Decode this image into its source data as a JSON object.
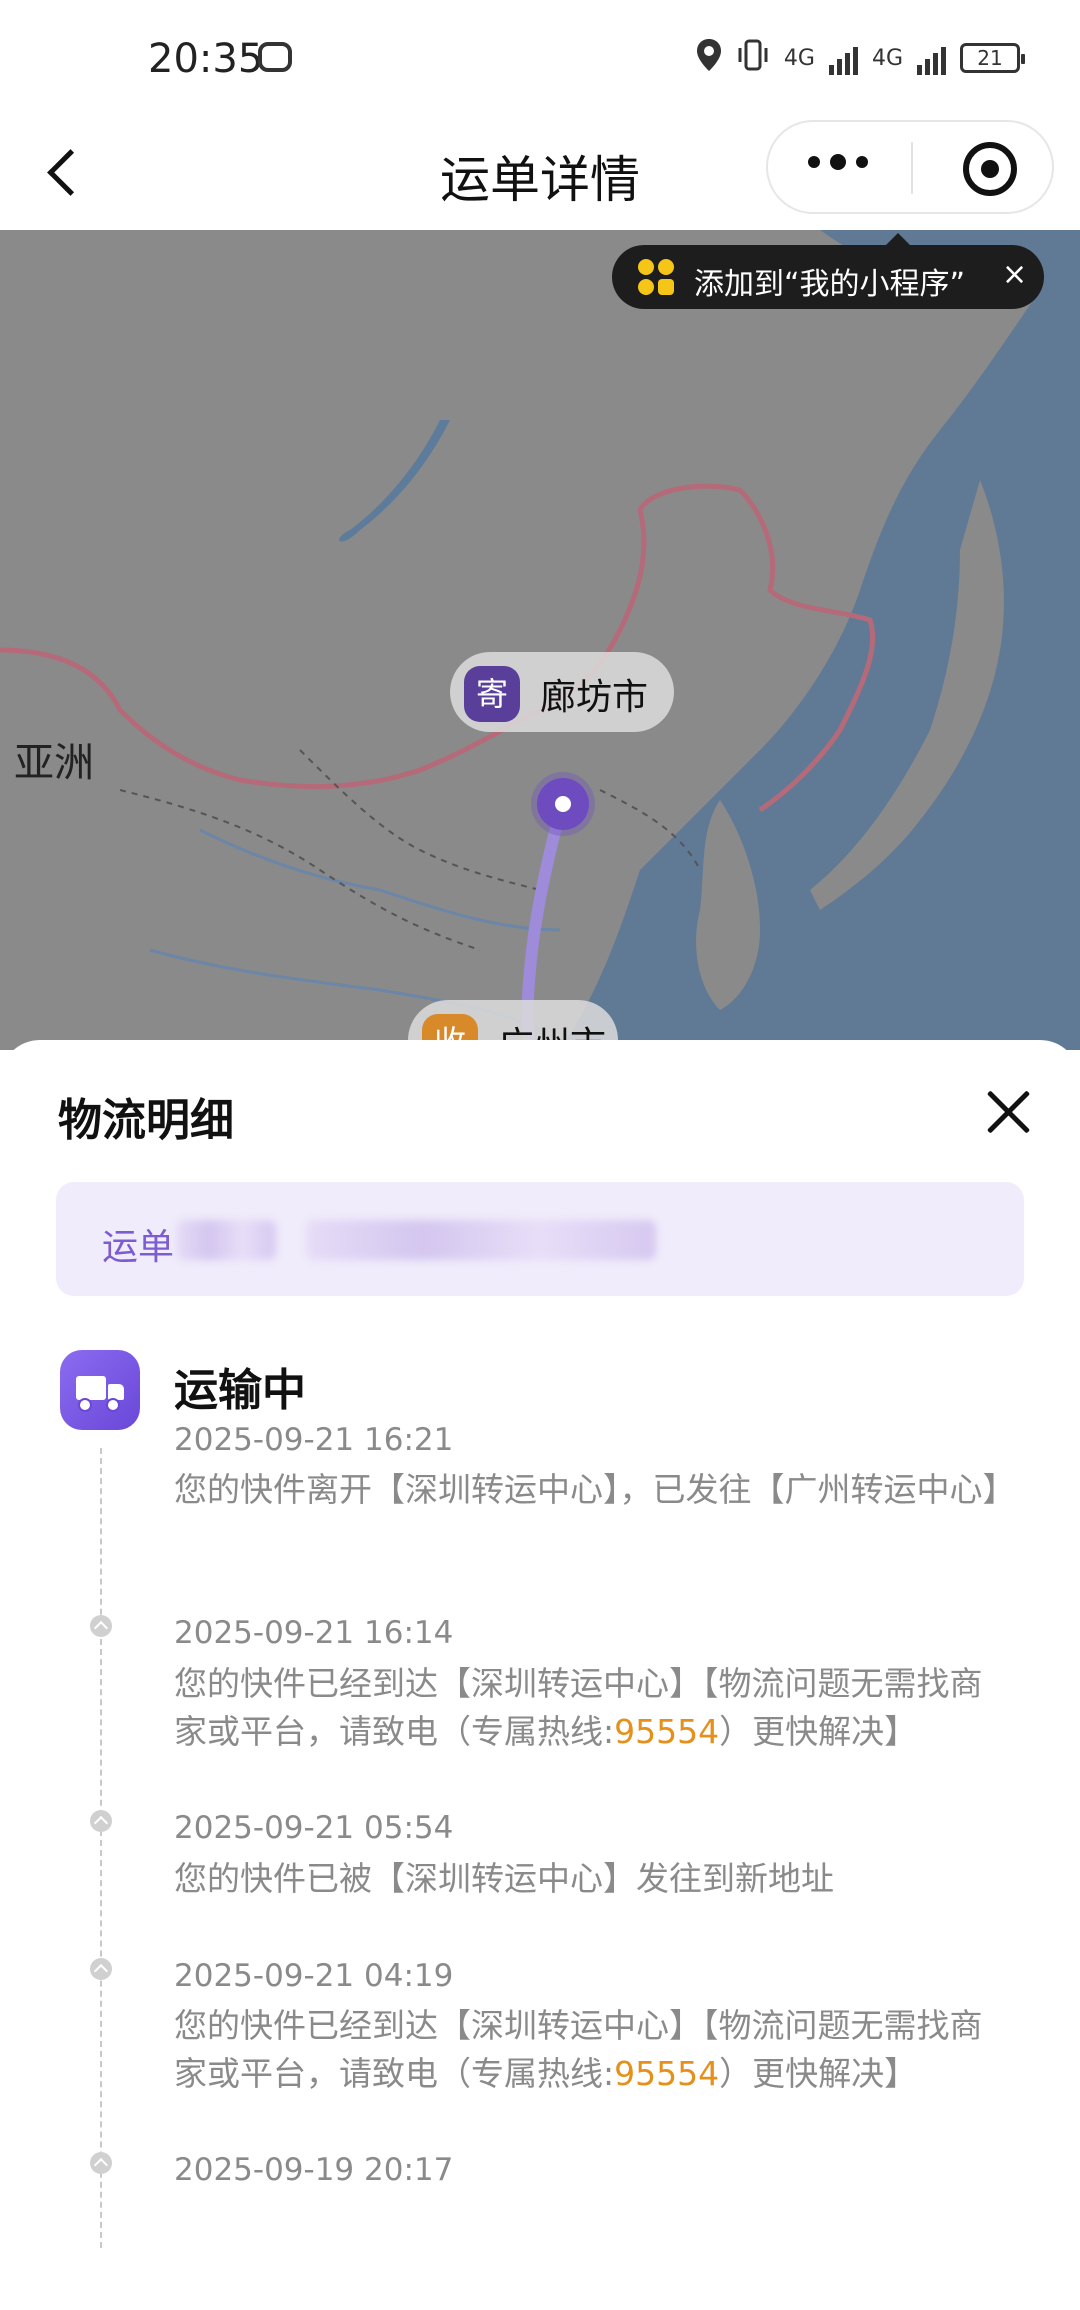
{
  "status_bar": {
    "time": "20:35",
    "network_1": "4G",
    "network_2": "4G",
    "battery": "21"
  },
  "nav": {
    "title": "运单详情"
  },
  "tooltip": {
    "text": "添加到“我的小程序”",
    "close": "×"
  },
  "map": {
    "region_label": "亚洲",
    "sender_badge": "寄",
    "sender_city": "廊坊市",
    "receiver_badge": "收",
    "receiver_city": "广州市",
    "route_color": "#6e4cc0"
  },
  "sheet": {
    "title": "物流明细",
    "waybill_label": "运单"
  },
  "timeline": {
    "status": "运输中",
    "events": [
      {
        "time": "2025-09-21 16:21",
        "text": "您的快件离开【深圳转运中心】，已发往【广州转运中心】"
      },
      {
        "time": "2025-09-21 16:14",
        "text_before": "您的快件已经到达【深圳转运中心】【物流问题无需找商家或平台，请致电（专属热线:",
        "hotline": "95554",
        "text_after": "）更快解决】"
      },
      {
        "time": "2025-09-21 05:54",
        "text": "您的快件已被【深圳转运中心】发往到新地址"
      },
      {
        "time": "2025-09-21 04:19",
        "text_before": "您的快件已经到达【深圳转运中心】【物流问题无需找商家或平台，请致电（专属热线:",
        "hotline": "95554",
        "text_after": "）更快解决】"
      },
      {
        "time": "2025-09-19 20:17"
      }
    ]
  },
  "colors": {
    "accent": "#6a47d8",
    "hotline": "#e5901a",
    "waybill_bg": "#f0ecfb"
  }
}
